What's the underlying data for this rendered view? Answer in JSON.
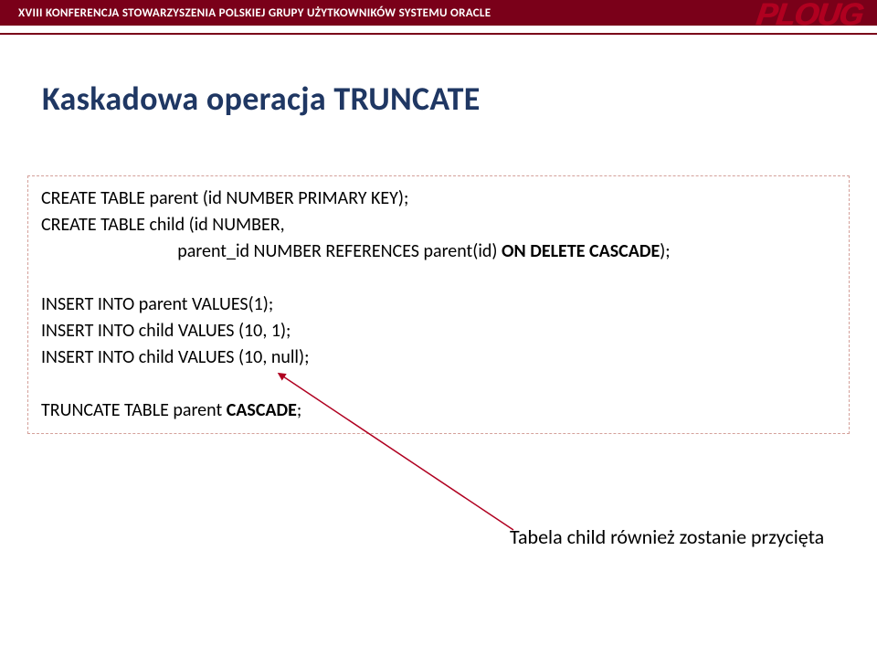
{
  "header": {
    "conference_text": "XVIII KONFERENCJA STOWARZYSZENIA POLSKIEJ GRUPY UŻYTKOWNIKÓW SYSTEMU ORACLE",
    "logo_text": "PLOUG"
  },
  "slide": {
    "title": "Kaskadowa operacja TRUNCATE"
  },
  "code": {
    "line1a": "CREATE TABLE parent (id NUMBER PRIMARY KEY);",
    "line2a": "CREATE TABLE child (id NUMBER,",
    "line2b": "                                 parent_id NUMBER REFERENCES parent(id) ",
    "line2c": "ON DELETE CASCADE",
    "line2d": ");",
    "gap1": " ",
    "line3": "INSERT INTO parent VALUES(1);",
    "line4": "INSERT INTO child VALUES (10, 1);",
    "line5": "INSERT INTO child VALUES (10, null);",
    "gap2": " ",
    "line6a": "TRUNCATE TABLE parent ",
    "line6b": "CASCADE",
    "line6c": ";"
  },
  "annotation": {
    "text": "Tabela child również zostanie przycięta"
  }
}
